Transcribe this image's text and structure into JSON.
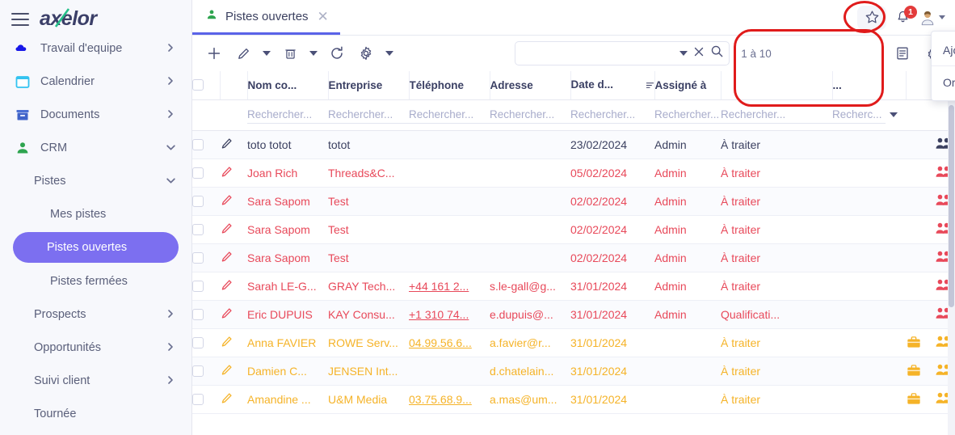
{
  "app": {
    "logo_text": "axelor",
    "brand_color": "#3b3f68",
    "accent_green": "#25c08a",
    "accent_purple": "#7c6ff0"
  },
  "sidebar": {
    "items": [
      {
        "label": "Travail d'equipe",
        "icon": "cloud-icon",
        "chevron": "right",
        "level": 0
      },
      {
        "label": "Calendrier",
        "icon": "calendar-icon",
        "chevron": "right",
        "level": 0
      },
      {
        "label": "Documents",
        "icon": "archive-icon",
        "chevron": "right",
        "level": 0
      },
      {
        "label": "CRM",
        "icon": "person-icon",
        "chevron": "down",
        "level": 0
      },
      {
        "label": "Pistes",
        "icon": "",
        "chevron": "down",
        "level": 1
      },
      {
        "label": "Mes pistes",
        "icon": "",
        "chevron": "",
        "level": 2
      },
      {
        "label": "Pistes ouvertes",
        "icon": "",
        "chevron": "",
        "level": 2,
        "active": true
      },
      {
        "label": "Pistes fermées",
        "icon": "",
        "chevron": "",
        "level": 2
      },
      {
        "label": "Prospects",
        "icon": "",
        "chevron": "right",
        "level": 1
      },
      {
        "label": "Opportunités",
        "icon": "",
        "chevron": "right",
        "level": 1
      },
      {
        "label": "Suivi client",
        "icon": "",
        "chevron": "right",
        "level": 1
      },
      {
        "label": "Tournée",
        "icon": "",
        "chevron": "",
        "level": 1
      }
    ]
  },
  "tabbar": {
    "tab_label": "Pistes ouvertes",
    "tab_icon": "person-icon",
    "close_icon": "close-icon",
    "star_icon": "star-icon",
    "bell_icon": "bell-icon",
    "bell_badge": "1",
    "avatar_icon": "avatar-icon"
  },
  "toolbar": {
    "add_icon": "plus-icon",
    "edit_icon": "pencil-icon",
    "edit_caret_icon": "chevron-down-icon",
    "delete_icon": "trash-icon",
    "delete_caret_icon": "chevron-down-icon",
    "refresh_icon": "refresh-icon",
    "settings_icon": "gear-icon",
    "settings_caret_icon": "chevron-down-icon",
    "search_value": "",
    "search_placeholder": "",
    "search_caret_icon": "chevron-down-icon",
    "clear_icon": "close-icon",
    "search_icon": "search-icon",
    "pager_text": "1 à 10",
    "list_view_icon": "list-icon",
    "config_icon": "gear-icon"
  },
  "favorites_menu": {
    "items": [
      {
        "label": "Ajouter aux favoris..."
      },
      {
        "label": "Organiser les favoris..."
      }
    ]
  },
  "grid": {
    "columns": [
      {
        "key": "check",
        "label": ""
      },
      {
        "key": "edit",
        "label": ""
      },
      {
        "key": "name",
        "label": "Nom co..."
      },
      {
        "key": "company",
        "label": "Entreprise"
      },
      {
        "key": "phone",
        "label": "Téléphone"
      },
      {
        "key": "address",
        "label": "Adresse"
      },
      {
        "key": "date",
        "label": "Date d...",
        "sort_icon": "sort-icon"
      },
      {
        "key": "assigned",
        "label": "Assigné à"
      },
      {
        "key": "status",
        "label": ""
      },
      {
        "key": "more",
        "label": "..."
      }
    ],
    "filter_placeholder": "Rechercher...",
    "filter_placeholder_short": "Recherc...",
    "filter_caret_icon": "chevron-down-icon",
    "rows": [
      {
        "name": "toto totot",
        "company": "totot",
        "phone": "",
        "address": "",
        "date": "23/02/2024",
        "assigned": "Admin",
        "status": "À traiter",
        "color": "#3c4160",
        "briefcase": false,
        "people_icon": "people-icon"
      },
      {
        "name": "Joan Rich",
        "company": "Threads&C...",
        "phone": "",
        "address": "",
        "date": "05/02/2024",
        "assigned": "Admin",
        "status": "À traiter",
        "color": "#e8495a",
        "briefcase": false,
        "people_icon": "people-icon"
      },
      {
        "name": "Sara Sapom",
        "company": "Test",
        "phone": "",
        "address": "",
        "date": "02/02/2024",
        "assigned": "Admin",
        "status": "À traiter",
        "color": "#e8495a",
        "briefcase": false,
        "people_icon": "people-icon"
      },
      {
        "name": "Sara Sapom",
        "company": "Test",
        "phone": "",
        "address": "",
        "date": "02/02/2024",
        "assigned": "Admin",
        "status": "À traiter",
        "color": "#e8495a",
        "briefcase": false,
        "people_icon": "people-icon"
      },
      {
        "name": "Sara Sapom",
        "company": "Test",
        "phone": "",
        "address": "",
        "date": "02/02/2024",
        "assigned": "Admin",
        "status": "À traiter",
        "color": "#e8495a",
        "briefcase": false,
        "people_icon": "people-icon"
      },
      {
        "name": "Sarah LE-G...",
        "company": "GRAY Tech...",
        "phone": "+44 161 2...",
        "address": "s.le-gall@g...",
        "date": "31/01/2024",
        "assigned": "Admin",
        "status": "À traiter",
        "color": "#e8495a",
        "briefcase": false,
        "people_icon": "people-icon"
      },
      {
        "name": "Eric DUPUIS",
        "company": "KAY Consu...",
        "phone": "+1 310 74...",
        "address": "e.dupuis@...",
        "date": "31/01/2024",
        "assigned": "Admin",
        "status": "Qualificati...",
        "color": "#e8495a",
        "briefcase": false,
        "people_icon": "people-icon"
      },
      {
        "name": "Anna FAVIER",
        "company": "ROWE Serv...",
        "phone": "04.99.56.6...",
        "address": "a.favier@r...",
        "date": "31/01/2024",
        "assigned": "",
        "status": "À traiter",
        "color": "#f5b328",
        "briefcase": true,
        "people_icon": "people-icon"
      },
      {
        "name": "Damien C...",
        "company": "JENSEN Int...",
        "phone": "",
        "address": "d.chatelain...",
        "date": "31/01/2024",
        "assigned": "",
        "status": "À traiter",
        "color": "#f5b328",
        "briefcase": true,
        "people_icon": "people-icon"
      },
      {
        "name": "Amandine ...",
        "company": "U&M Media",
        "phone": "03.75.68.9...",
        "address": "a.mas@um...",
        "date": "31/01/2024",
        "assigned": "",
        "status": "À traiter",
        "color": "#f5b328",
        "briefcase": true,
        "people_icon": "people-icon"
      }
    ]
  },
  "annotations": {
    "circle_color": "#e01b1b"
  }
}
